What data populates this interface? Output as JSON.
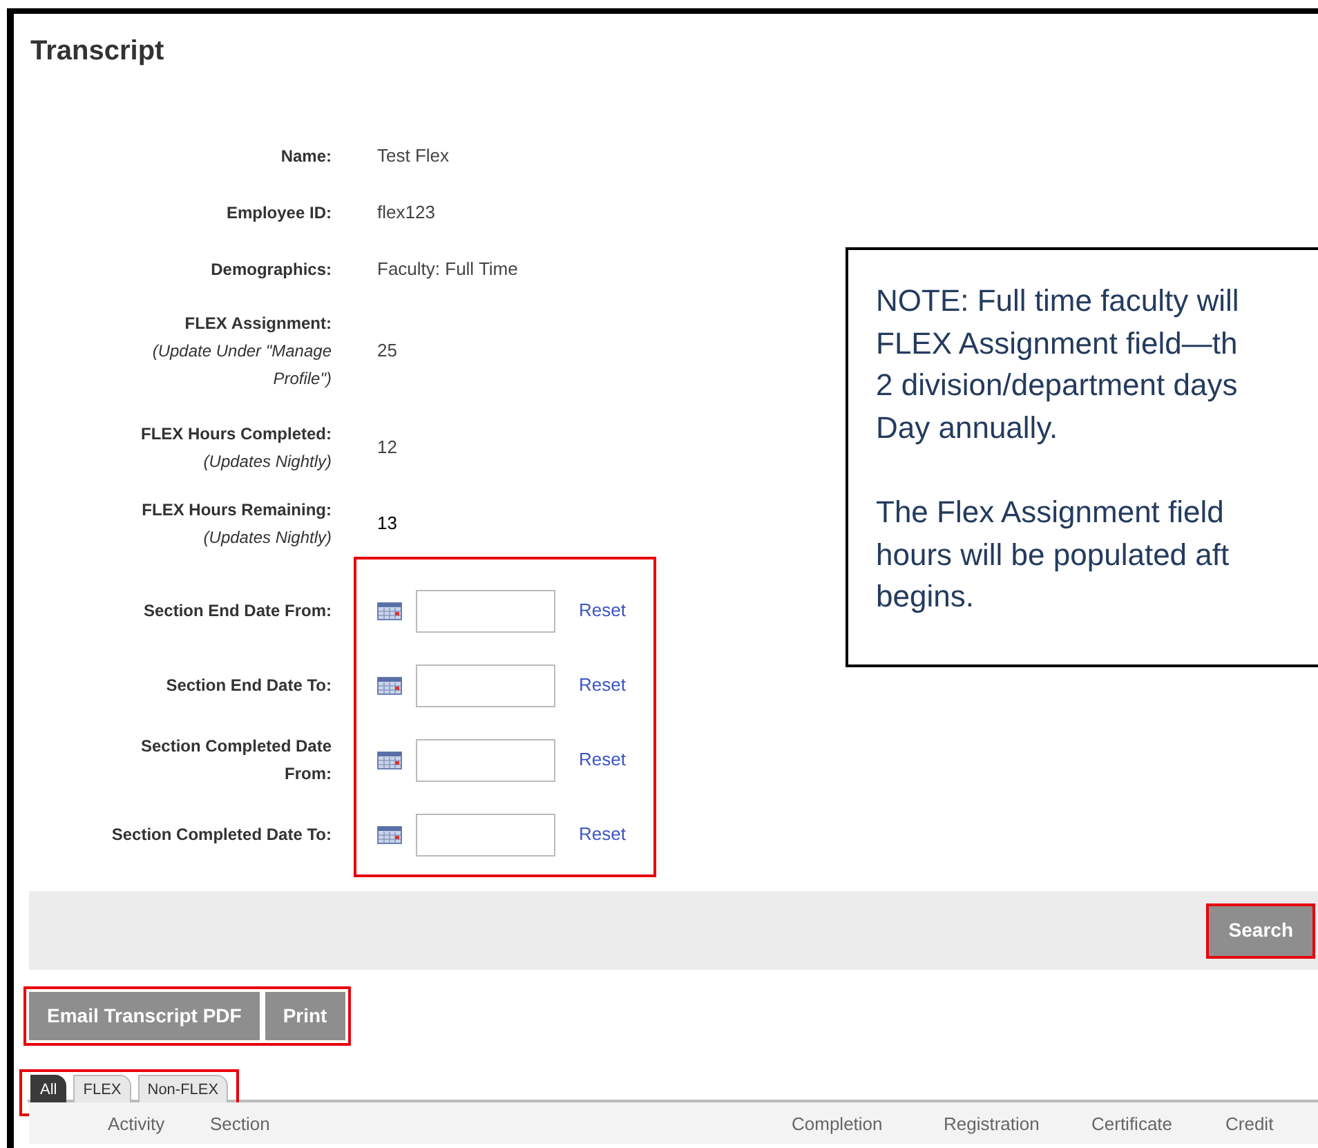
{
  "title": "Transcript",
  "fields": [
    {
      "label": "Name:",
      "value": "Test Flex"
    },
    {
      "label": "Employee ID:",
      "value": "flex123"
    },
    {
      "label": "Demographics:",
      "value": "Faculty: Full Time"
    },
    {
      "label": "FLEX Assignment:",
      "hint": "(Update Under \"Manage Profile\")",
      "value": "25"
    },
    {
      "label": "FLEX Hours Completed:",
      "hint": "(Updates Nightly)",
      "value": "12"
    },
    {
      "label": "FLEX Hours Remaining:",
      "hint": "(Updates Nightly)",
      "value": "13"
    }
  ],
  "date_filters": {
    "highlighted": true,
    "rows": [
      {
        "label": "Section End Date From:",
        "reset": "Reset"
      },
      {
        "label": "Section End Date To:",
        "reset": "Reset"
      },
      {
        "label": "Section Completed Date From:",
        "reset": "Reset"
      },
      {
        "label": "Section Completed Date To:",
        "reset": "Reset"
      }
    ]
  },
  "search_button": {
    "label": "Search",
    "highlighted": true
  },
  "action_buttons": {
    "highlighted": true,
    "items": [
      "Email Transcript PDF",
      "Print"
    ]
  },
  "tabs": {
    "highlighted": true,
    "items": [
      {
        "label": "All",
        "selected": true
      },
      {
        "label": "FLEX",
        "selected": false
      },
      {
        "label": "Non-FLEX",
        "selected": false
      }
    ]
  },
  "table": {
    "columns": [
      "Activity",
      "Section",
      "Completion",
      "Registration",
      "Certificate",
      "Credit"
    ]
  },
  "note": {
    "paragraphs": [
      [
        "NOTE: Full time faculty will",
        "FLEX Assignment field—th",
        "2 division/department days",
        "Day annually."
      ],
      [
        "The Flex Assignment field",
        "hours will be populated aft",
        "begins."
      ]
    ]
  }
}
